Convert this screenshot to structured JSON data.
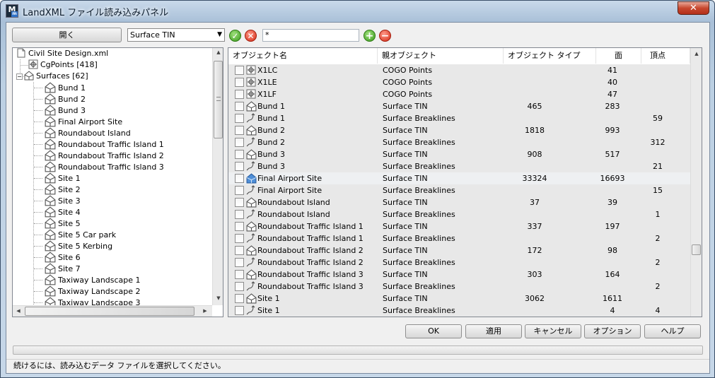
{
  "window": {
    "title": "LandXML ファイル読み込みパネル",
    "app_icon_letter": "M",
    "app_icon_sub": "m",
    "close_glyph": "✕"
  },
  "toolbar": {
    "open_label": "開く",
    "surface_select": "Surface TIN",
    "filter_value": "*",
    "accept_icon": "✓",
    "reject_icon": "✕",
    "add_icon": "+",
    "remove_icon": "−"
  },
  "tree": {
    "root": "Civil Site Design.xml",
    "cgpoints": "CgPoints [418]",
    "surfaces": "Surfaces [62]",
    "items": [
      "Bund 1",
      "Bund 2",
      "Bund 3",
      "Final Airport Site",
      "Roundabout Island",
      "Roundabout Traffic Island 1",
      "Roundabout Traffic Island 2",
      "Roundabout Traffic Island 3",
      "Site 1",
      "Site 2",
      "Site 3",
      "Site 4",
      "Site 5",
      "Site 5 Car park",
      "Site 5 Kerbing",
      "Site 6",
      "Site 7",
      "Taxiway Landscape 1",
      "Taxiway Landscape 2",
      "Taxiway Landscape 3"
    ]
  },
  "grid": {
    "columns": {
      "name": "オブジェクト名",
      "parent": "親オブジェクト",
      "type": "オブジェクト タイプ",
      "faces": "面",
      "vertices": "頂点"
    },
    "rows": [
      {
        "icon": "point",
        "name": "X1LC",
        "parent": "COGO Points",
        "type": "",
        "faces": "41",
        "vertices": ""
      },
      {
        "icon": "point",
        "name": "X1LE",
        "parent": "COGO Points",
        "type": "",
        "faces": "40",
        "vertices": ""
      },
      {
        "icon": "point",
        "name": "X1LF",
        "parent": "COGO Points",
        "type": "",
        "faces": "47",
        "vertices": ""
      },
      {
        "icon": "surface",
        "name": "Bund 1",
        "parent": "Surface TIN",
        "type": "465",
        "faces": "283",
        "vertices": ""
      },
      {
        "icon": "breakline",
        "name": "Bund 1",
        "parent": "Surface Breaklines",
        "type": "",
        "faces": "",
        "vertices": "59"
      },
      {
        "icon": "surface",
        "name": "Bund 2",
        "parent": "Surface TIN",
        "type": "1818",
        "faces": "993",
        "vertices": ""
      },
      {
        "icon": "breakline",
        "name": "Bund 2",
        "parent": "Surface Breaklines",
        "type": "",
        "faces": "",
        "vertices": "312"
      },
      {
        "icon": "surface",
        "name": "Bund 3",
        "parent": "Surface TIN",
        "type": "908",
        "faces": "517",
        "vertices": ""
      },
      {
        "icon": "breakline",
        "name": "Bund 3",
        "parent": "Surface Breaklines",
        "type": "",
        "faces": "",
        "vertices": "21"
      },
      {
        "icon": "surface-blue",
        "name": "Final Airport Site",
        "parent": "Surface TIN",
        "type": "33324",
        "faces": "16693",
        "vertices": ""
      },
      {
        "icon": "breakline",
        "name": "Final Airport Site",
        "parent": "Surface Breaklines",
        "type": "",
        "faces": "",
        "vertices": "15"
      },
      {
        "icon": "surface",
        "name": "Roundabout Island",
        "parent": "Surface TIN",
        "type": "37",
        "faces": "39",
        "vertices": ""
      },
      {
        "icon": "breakline",
        "name": "Roundabout Island",
        "parent": "Surface Breaklines",
        "type": "",
        "faces": "",
        "vertices": "1"
      },
      {
        "icon": "surface",
        "name": "Roundabout Traffic Island 1",
        "parent": "Surface TIN",
        "type": "337",
        "faces": "197",
        "vertices": ""
      },
      {
        "icon": "breakline",
        "name": "Roundabout Traffic Island 1",
        "parent": "Surface Breaklines",
        "type": "",
        "faces": "",
        "vertices": "2"
      },
      {
        "icon": "surface",
        "name": "Roundabout Traffic Island 2",
        "parent": "Surface TIN",
        "type": "172",
        "faces": "98",
        "vertices": ""
      },
      {
        "icon": "breakline",
        "name": "Roundabout Traffic Island 2",
        "parent": "Surface Breaklines",
        "type": "",
        "faces": "",
        "vertices": "2"
      },
      {
        "icon": "surface",
        "name": "Roundabout Traffic Island 3",
        "parent": "Surface TIN",
        "type": "303",
        "faces": "164",
        "vertices": ""
      },
      {
        "icon": "breakline",
        "name": "Roundabout Traffic Island 3",
        "parent": "Surface Breaklines",
        "type": "",
        "faces": "",
        "vertices": "2"
      },
      {
        "icon": "surface",
        "name": "Site 1",
        "parent": "Surface TIN",
        "type": "3062",
        "faces": "1611",
        "vertices": ""
      },
      {
        "icon": "breakline",
        "name": "Site 1",
        "parent": "Surface Breaklines",
        "type": "",
        "faces": "4",
        "vertices": "4"
      }
    ]
  },
  "buttons": {
    "ok": "OK",
    "apply": "適用",
    "cancel": "キャンセル",
    "options": "オプション",
    "help": "ヘルプ"
  },
  "status": {
    "message": "続けるには、読み込むデータ ファイルを選択してください。"
  },
  "colors": {
    "selected_row": "#eef0f2",
    "row_bg": "#e8e8e8",
    "surface_icon_blue": "#4f8fd8"
  }
}
